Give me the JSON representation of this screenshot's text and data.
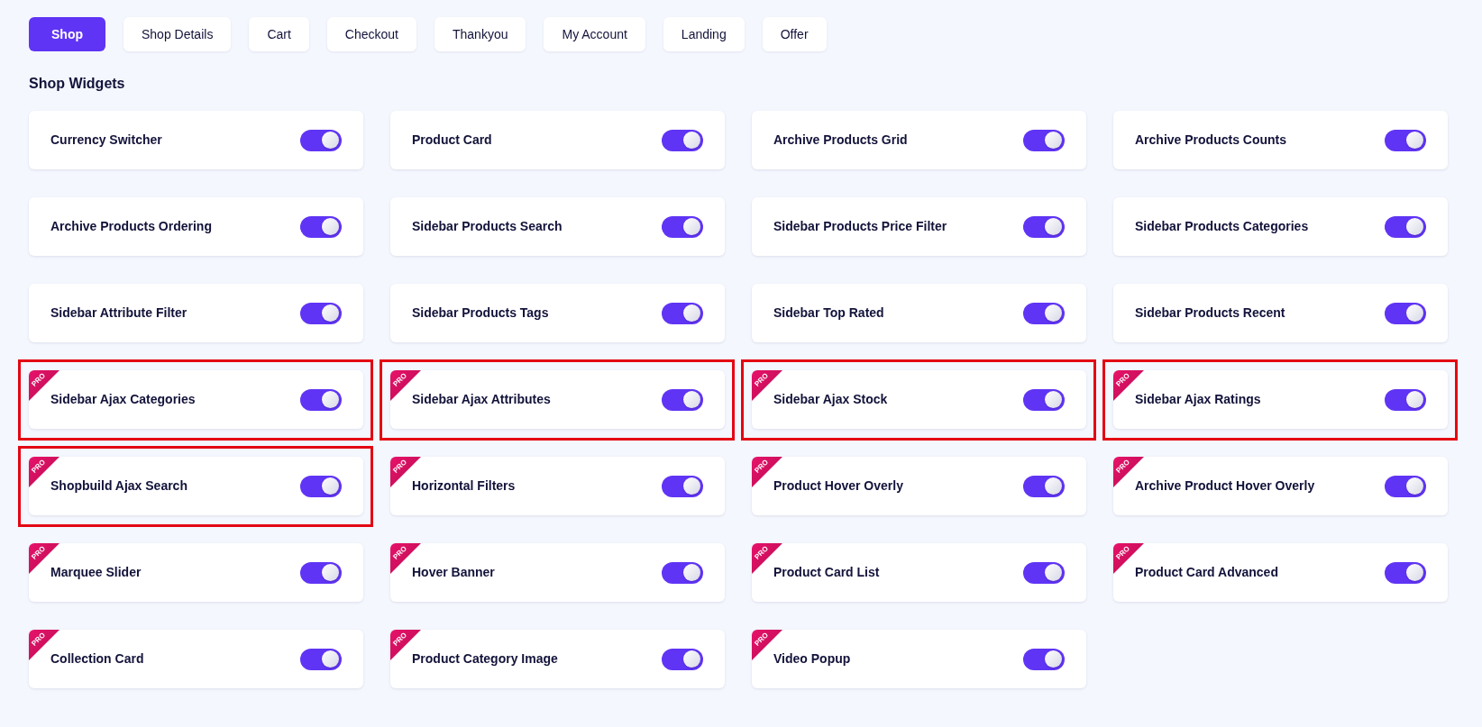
{
  "tabs": [
    {
      "label": "Shop",
      "selected": true
    },
    {
      "label": "Shop Details",
      "selected": false
    },
    {
      "label": "Cart",
      "selected": false
    },
    {
      "label": "Checkout",
      "selected": false
    },
    {
      "label": "Thankyou",
      "selected": false
    },
    {
      "label": "My Account",
      "selected": false
    },
    {
      "label": "Landing",
      "selected": false
    },
    {
      "label": "Offer",
      "selected": false
    }
  ],
  "section": {
    "title": "Shop Widgets"
  },
  "widgets": [
    {
      "name": "Currency Switcher",
      "on": true,
      "highlighted": false
    },
    {
      "name": "Product Card",
      "on": true,
      "highlighted": false
    },
    {
      "name": "Archive Products Grid",
      "on": true,
      "highlighted": false
    },
    {
      "name": "Archive Products Counts",
      "on": true,
      "highlighted": false
    },
    {
      "name": "Archive Products Ordering",
      "on": true,
      "highlighted": false
    },
    {
      "name": "Sidebar Products Search",
      "on": true,
      "highlighted": false
    },
    {
      "name": "Sidebar Products Price Filter",
      "on": true,
      "highlighted": false
    },
    {
      "name": "Sidebar Products Categories",
      "on": true,
      "highlighted": false
    },
    {
      "name": "Sidebar Attribute Filter",
      "on": true,
      "highlighted": false
    },
    {
      "name": "Sidebar Products Tags",
      "on": true,
      "highlighted": false
    },
    {
      "name": "Sidebar Top Rated",
      "on": true,
      "highlighted": false
    },
    {
      "name": "Sidebar Products Recent",
      "on": true,
      "highlighted": false
    },
    {
      "name": "Sidebar Ajax Categories",
      "badge": "PRO",
      "on": true,
      "highlighted": true
    },
    {
      "name": "Sidebar Ajax Attributes",
      "badge": "PRO",
      "on": true,
      "highlighted": true
    },
    {
      "name": "Sidebar Ajax Stock",
      "badge": "PRO",
      "on": true,
      "highlighted": true
    },
    {
      "name": "Sidebar Ajax Ratings",
      "badge": "PRO",
      "on": true,
      "highlighted": true
    },
    {
      "name": "Shopbuild Ajax Search",
      "badge": "PRO",
      "on": true,
      "highlighted": true
    },
    {
      "name": "Horizontal Filters",
      "badge": "PRO",
      "on": true,
      "highlighted": false
    },
    {
      "name": "Product Hover Overly",
      "badge": "PRO",
      "on": true,
      "highlighted": false
    },
    {
      "name": "Archive Product Hover Overly",
      "badge": "PRO",
      "on": true,
      "highlighted": false
    },
    {
      "name": "Marquee Slider",
      "badge": "PRO",
      "on": true,
      "highlighted": false
    },
    {
      "name": "Hover Banner",
      "badge": "PRO",
      "on": true,
      "highlighted": false
    },
    {
      "name": "Product Card List",
      "badge": "PRO",
      "on": true,
      "highlighted": false
    },
    {
      "name": "Product Card Advanced",
      "badge": "PRO",
      "on": true,
      "highlighted": false
    },
    {
      "name": "Collection Card",
      "badge": "PRO",
      "on": true,
      "highlighted": false
    },
    {
      "name": "Product Category Image",
      "badge": "PRO",
      "on": true,
      "highlighted": false
    },
    {
      "name": "Video Popup",
      "badge": "PRO",
      "on": true,
      "highlighted": false
    }
  ]
}
